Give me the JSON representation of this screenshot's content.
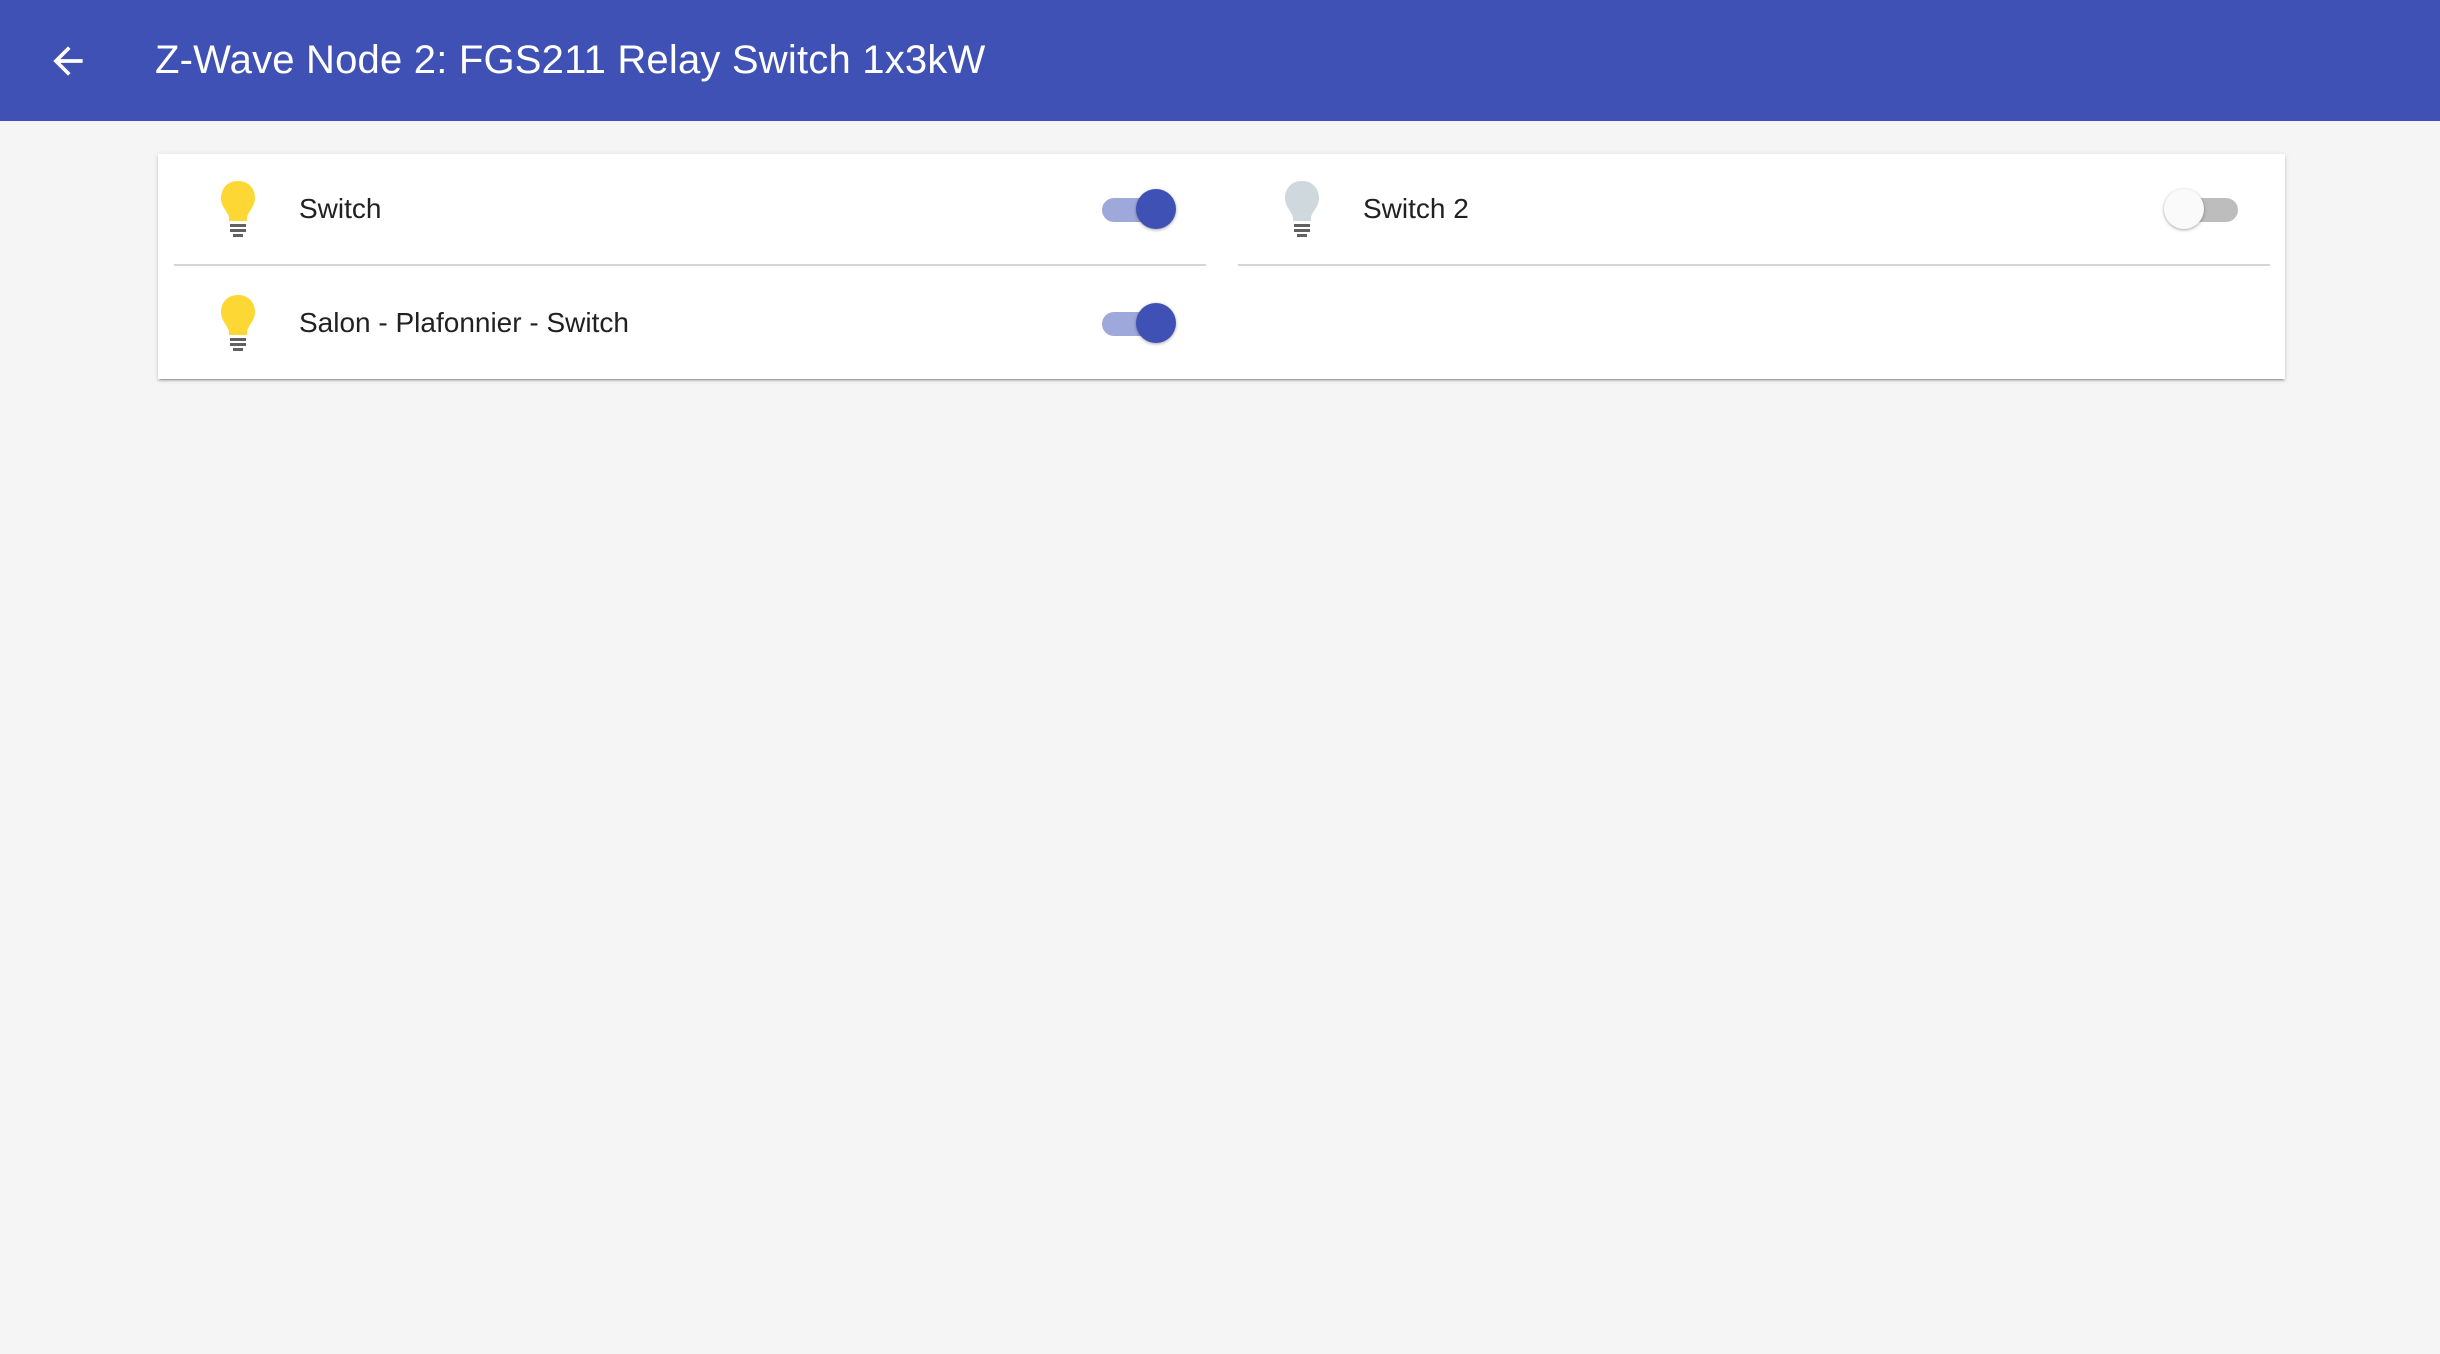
{
  "header": {
    "title": "Z-Wave Node 2: FGS211 Relay Switch 1x3kW",
    "back_icon": "arrow-left-icon",
    "background": "#3f51b5"
  },
  "entities": [
    {
      "label": "Switch",
      "state": "on",
      "icon": "lightbulb-icon",
      "icon_color": "#fdd835"
    },
    {
      "label": "Switch 2",
      "state": "off",
      "icon": "lightbulb-icon",
      "icon_color": "#cfd8dc"
    },
    {
      "label": "Salon - Plafonnier - Switch",
      "state": "on",
      "icon": "lightbulb-icon",
      "icon_color": "#fdd835"
    }
  ],
  "colors": {
    "accent": "#3f51b5",
    "bulb_on": "#fdd835",
    "bulb_off": "#cfd8dc",
    "page_bg": "#f5f5f5"
  }
}
